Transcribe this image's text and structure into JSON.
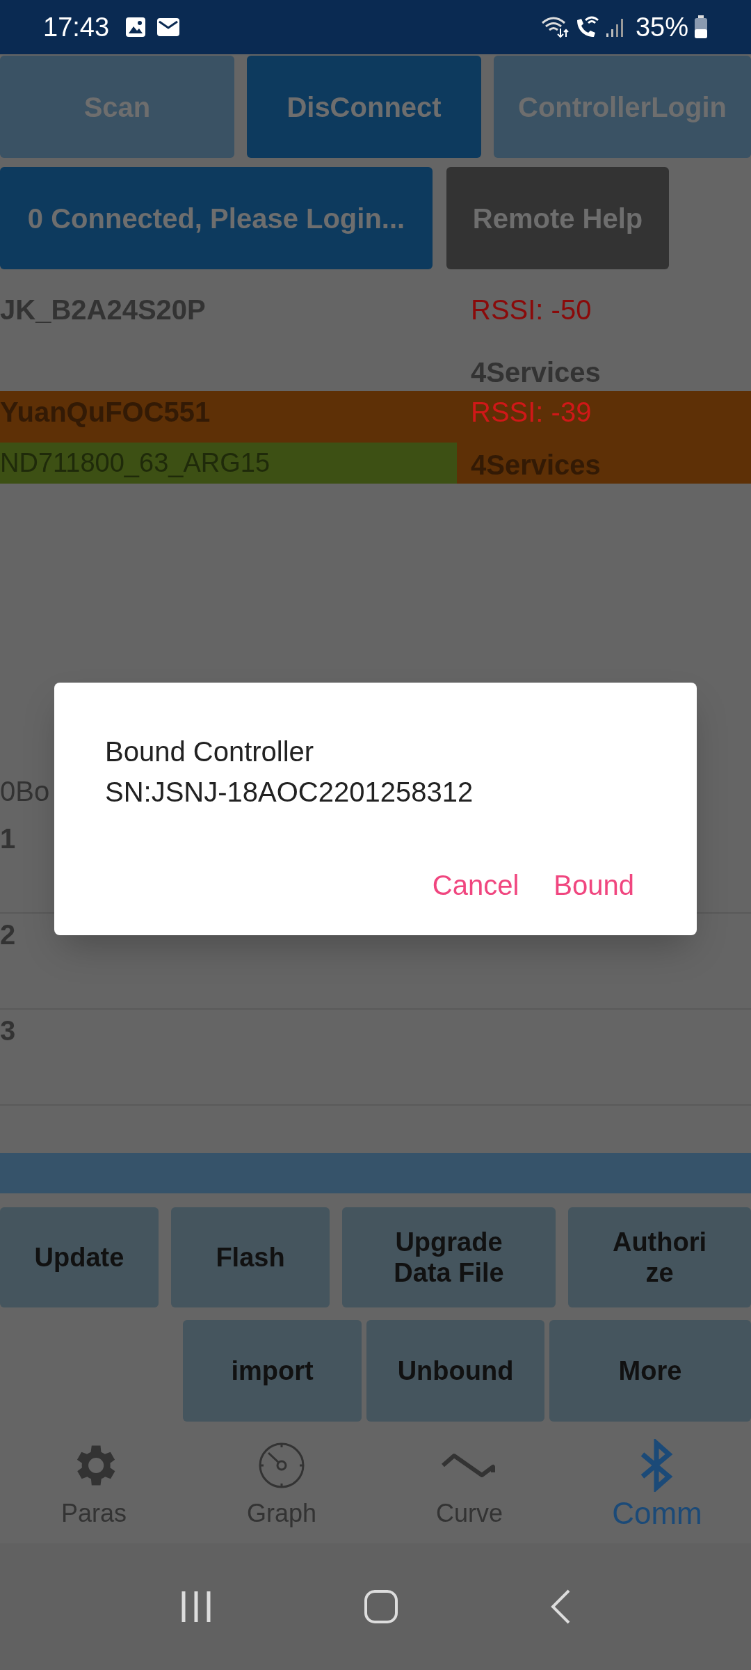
{
  "status_bar": {
    "time": "17:43",
    "battery": "35%"
  },
  "top_buttons": [
    {
      "label": "Scan",
      "kind": "dim"
    },
    {
      "label": "DisConnect",
      "kind": "primary"
    },
    {
      "label": "ControllerLogin",
      "kind": "dim"
    }
  ],
  "connection_button": {
    "label": "0 Connected, Please Login..."
  },
  "remote_help_button": {
    "label": "Remote Help"
  },
  "devices": [
    {
      "name": "JK_B2A24S20P",
      "rssi": "RSSI: -50",
      "services": "4Services",
      "selected": false
    },
    {
      "name": "YuanQuFOC551",
      "subtitle": "ND711800_63_ARG15",
      "rssi": "RSSI: -39",
      "services": "4Services",
      "selected": true
    }
  ],
  "bound_label": "0Bo",
  "bound_rows": [
    "1",
    "2",
    "3"
  ],
  "action_buttons": [
    {
      "label": "Update"
    },
    {
      "label": "Flash"
    },
    {
      "label": "Upgrade Data File"
    },
    {
      "label": "Authorize"
    }
  ],
  "action_buttons_2": [
    {
      "label": "import"
    },
    {
      "label": "Unbound"
    },
    {
      "label": "More"
    }
  ],
  "bottom_nav": [
    {
      "label": "Paras",
      "kind": "gear",
      "selected": false
    },
    {
      "label": "Graph",
      "kind": "gauge",
      "selected": false
    },
    {
      "label": "Curve",
      "kind": "wave",
      "selected": false
    },
    {
      "label": "Comm",
      "kind": "bluetooth",
      "selected": true
    }
  ],
  "dialog": {
    "message": "Bound Controller\nSN:JSNJ-18AOC2201258312",
    "buttons": [
      "Cancel",
      "Bound"
    ]
  }
}
